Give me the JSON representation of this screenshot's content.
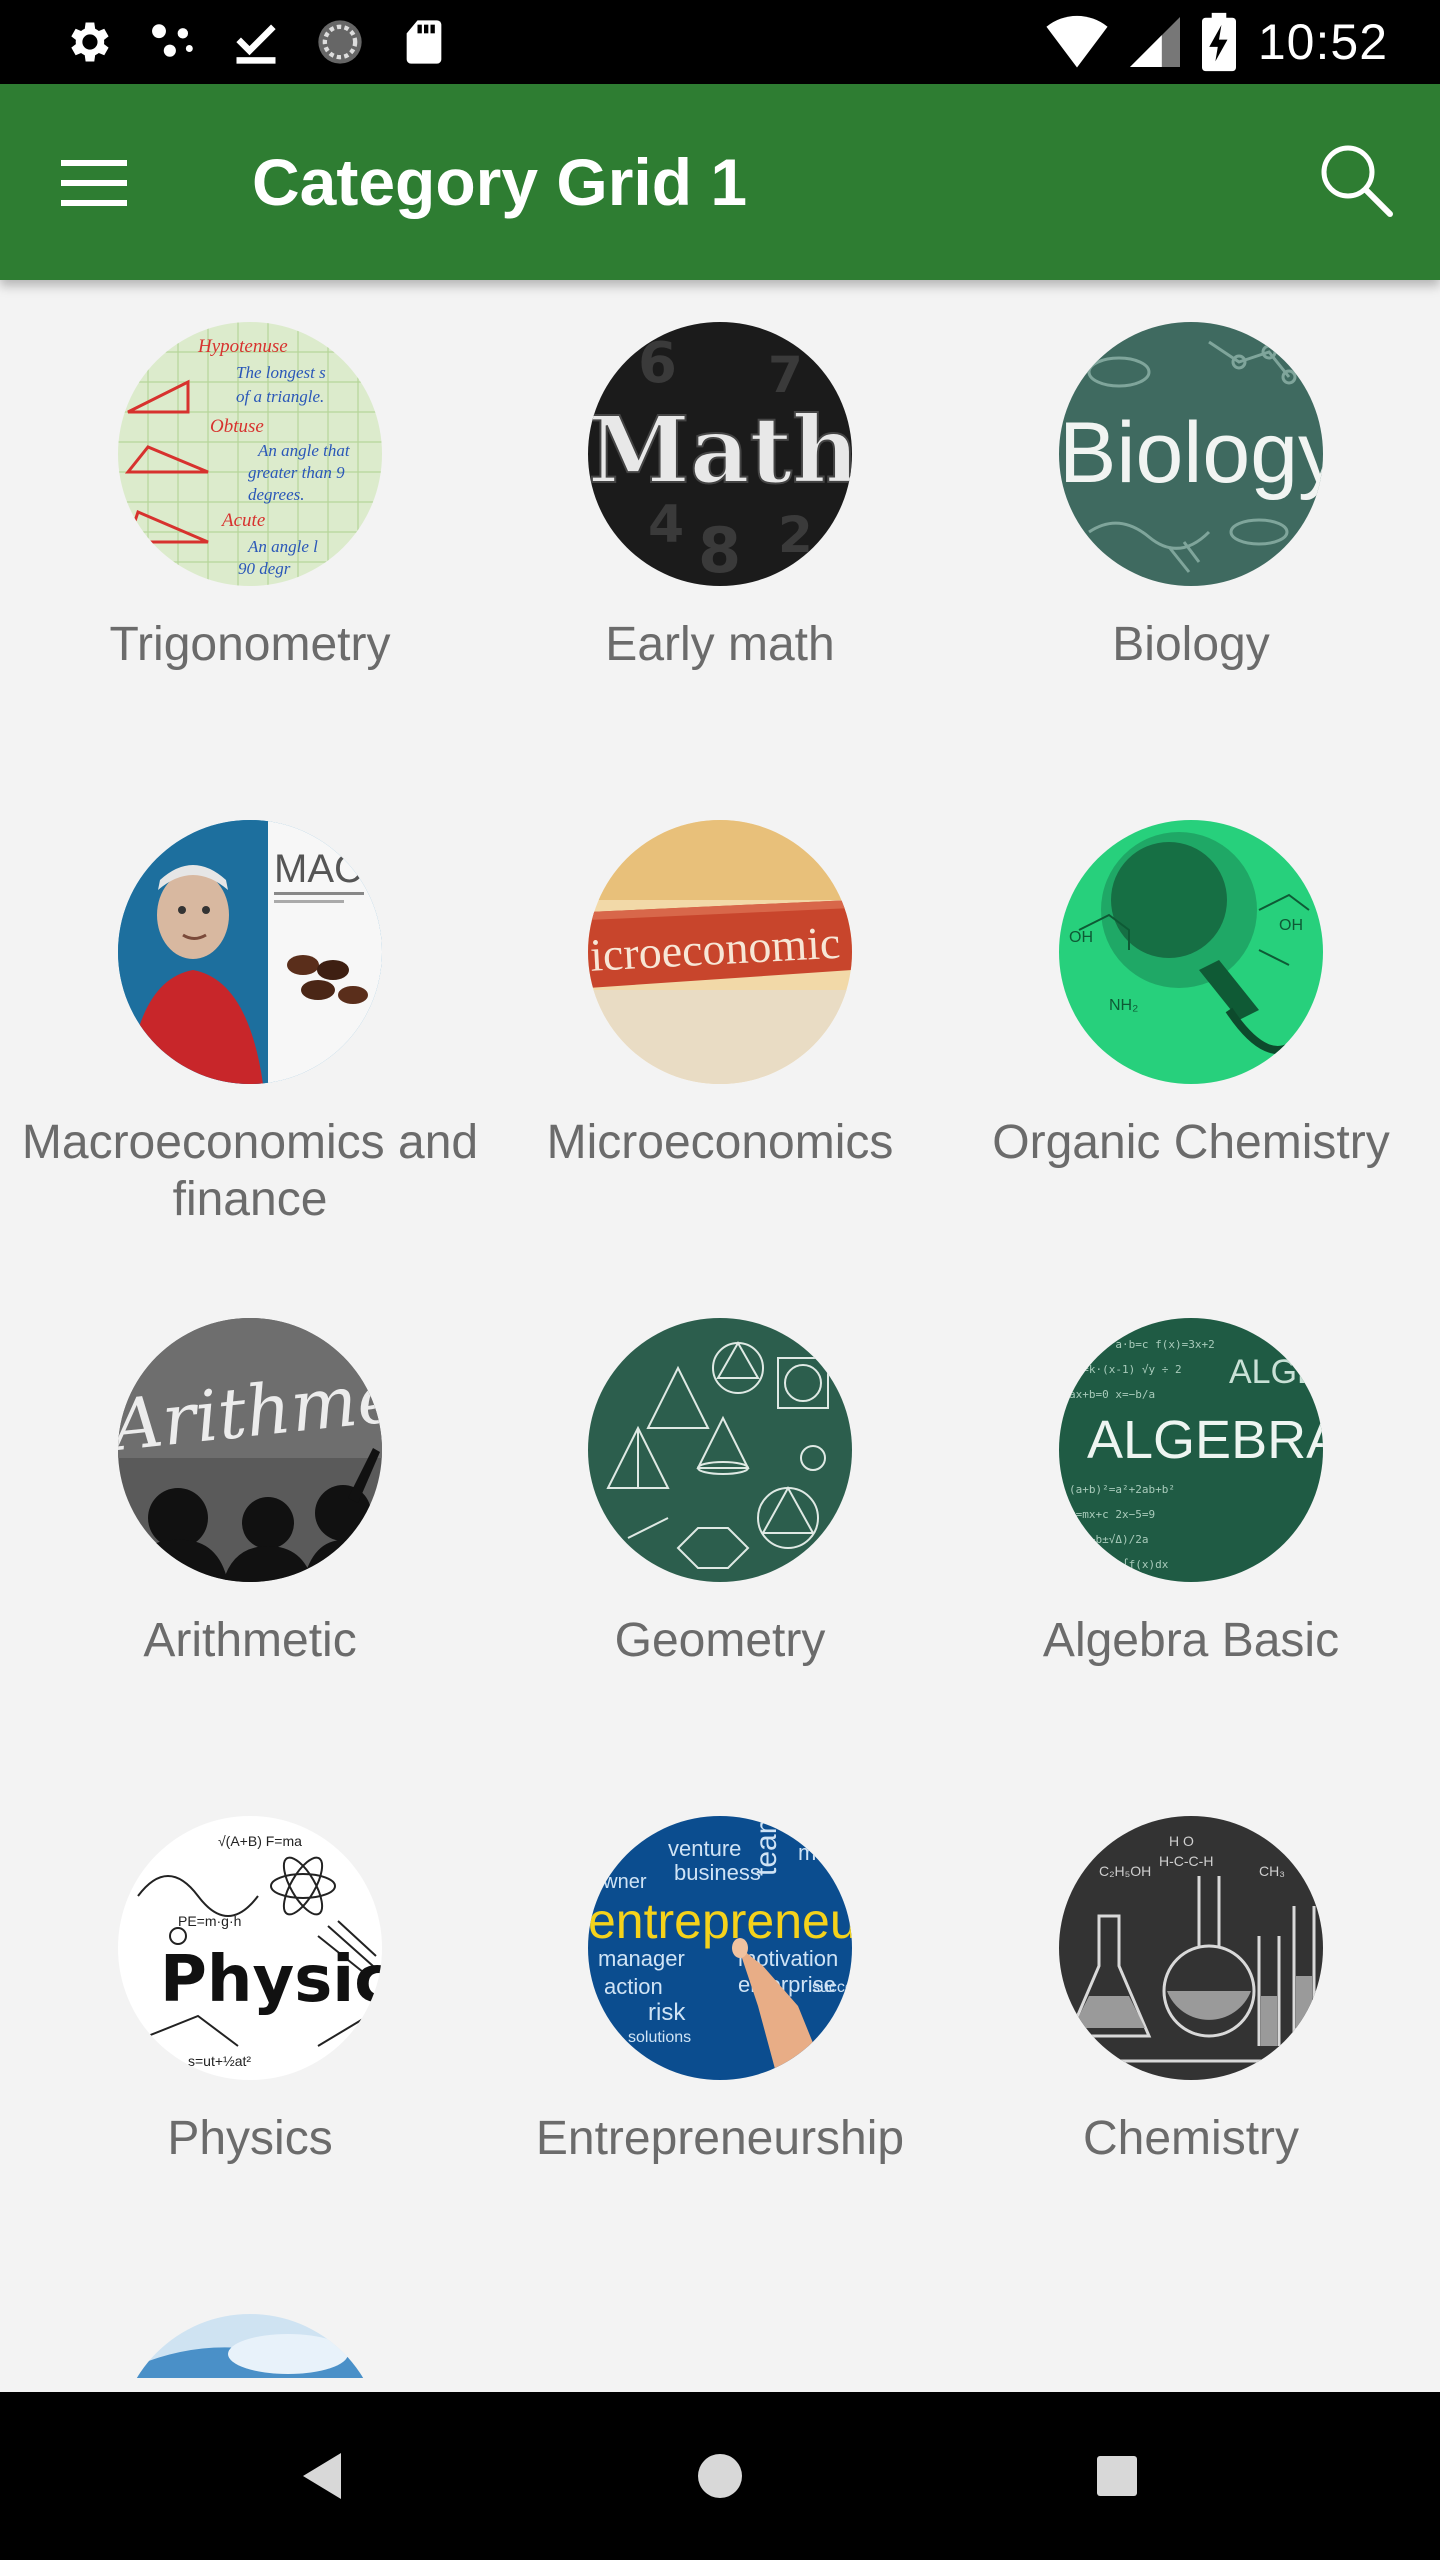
{
  "status_bar": {
    "time": "10:52",
    "left_icons": [
      "settings-icon",
      "nodes-icon",
      "download-done-icon",
      "sync-circle-icon",
      "sd-card-icon"
    ],
    "right_icons": [
      "wifi-icon",
      "cell-signal-icon",
      "battery-charging-icon"
    ]
  },
  "app_bar": {
    "title": "Category Grid 1",
    "menu_icon": "hamburger-menu-icon",
    "search_icon": "search-icon",
    "color": "#2e7d32"
  },
  "categories": [
    {
      "label": "Trigonometry",
      "image": "trigonometry-notes"
    },
    {
      "label": "Early math",
      "image": "math-chalkboard"
    },
    {
      "label": "Biology",
      "image": "biology-chalkboard"
    },
    {
      "label": "Macroeconomics and finance",
      "image": "macroeconomics-book"
    },
    {
      "label": "Microeconomics",
      "image": "microeconomics-book-spine"
    },
    {
      "label": "Organic Chemistry",
      "image": "chemistry-flask-green"
    },
    {
      "label": "Arithmetic",
      "image": "arithmetic-chalkboard"
    },
    {
      "label": "Geometry",
      "image": "geometry-chalkboard"
    },
    {
      "label": "Algebra Basic",
      "image": "algebra-chalkboard"
    },
    {
      "label": "Physics",
      "image": "physics-doodles"
    },
    {
      "label": "Entrepreneurship",
      "image": "entrepreneur-words"
    },
    {
      "label": "Chemistry",
      "image": "chemistry-glassware"
    }
  ],
  "nav_bar": {
    "icons": [
      "back-icon",
      "home-icon",
      "recents-icon"
    ]
  }
}
